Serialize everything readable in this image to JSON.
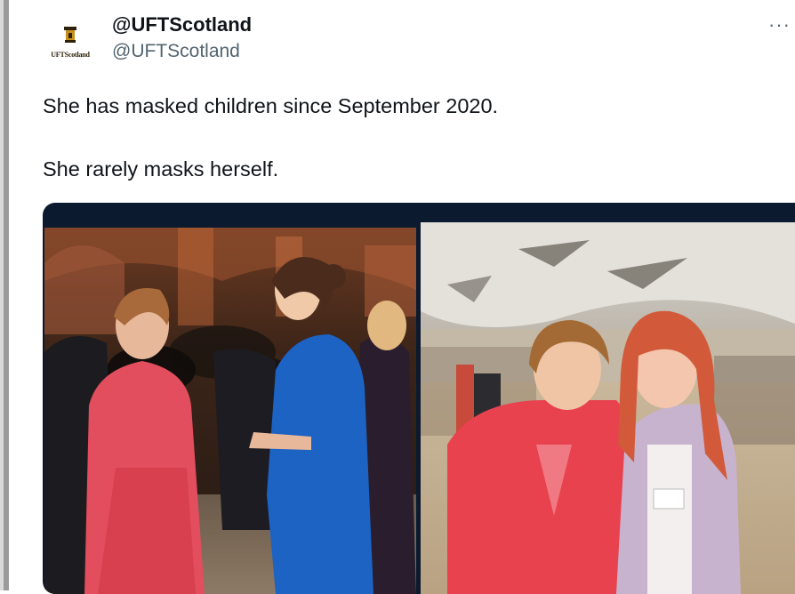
{
  "author": {
    "display_name": "@UFTScotland",
    "handle": "@UFTScotland",
    "avatar_text": "UFTScotland"
  },
  "menu": {
    "more_icon": "ellipsis-icon",
    "more_label": "···"
  },
  "tweet": {
    "lines": [
      "She has masked children since September 2020.",
      "She rarely masks herself."
    ]
  },
  "media": {
    "left_photo": "photo-formal-event",
    "right_photo": "photo-parliament-event"
  },
  "colors": {
    "text_primary": "#0f1419",
    "text_secondary": "#536471",
    "media_background": "#0b1a2f"
  }
}
